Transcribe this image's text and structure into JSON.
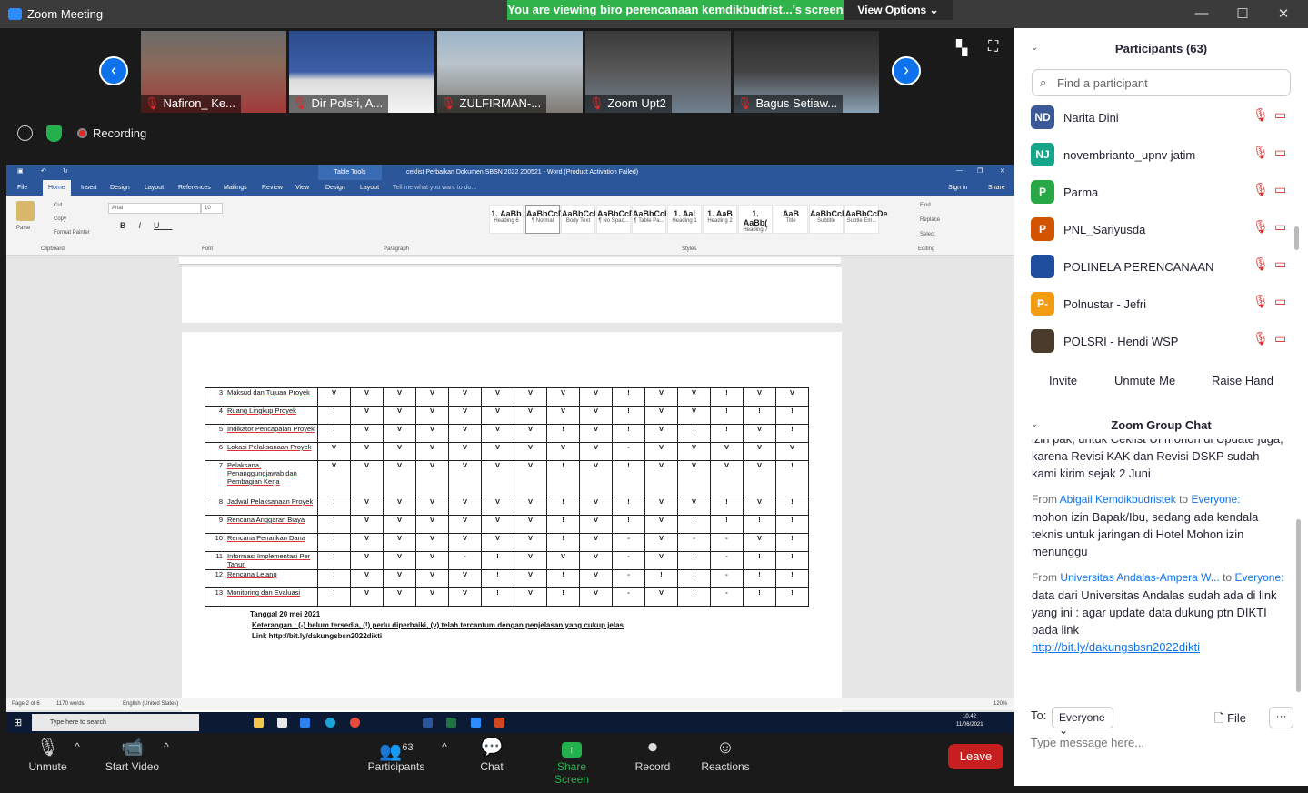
{
  "window": {
    "title": "Zoom Meeting"
  },
  "banner": {
    "text": "You are viewing biro perencanaan kemdikbudrist...'s screen",
    "view_options": "View Options ⌄"
  },
  "tiles": [
    {
      "label": "Nafiron_ Ke..."
    },
    {
      "label": "Dir Polsri, A..."
    },
    {
      "label": "ZULFIRMAN-..."
    },
    {
      "label": "Zoom Upt2"
    },
    {
      "label": "Bagus Setiaw..."
    }
  ],
  "recording": "Recording",
  "word": {
    "table_tools": "Table Tools",
    "doc_title": "ceklist Perbaikan Dokumen SBSN 2022 200521 - Word (Product Activation Failed)",
    "tabs": [
      "File",
      "Home",
      "Insert",
      "Design",
      "Layout",
      "References",
      "Mailings",
      "Review",
      "View",
      "Design",
      "Layout"
    ],
    "tell_me": "Tell me what you want to do...",
    "sign_in": "Sign in",
    "share": "Share",
    "font": "Arial",
    "size": "10",
    "clipboard": [
      "Paste",
      "Cut",
      "Copy",
      "Format Painter"
    ],
    "groups": [
      "Clipboard",
      "Font",
      "Paragraph",
      "Styles",
      "Editing"
    ],
    "styles": [
      {
        "p": "1. AaBb",
        "n": "Heading 6"
      },
      {
        "p": "AaBbCcDc",
        "n": "¶ Normal"
      },
      {
        "p": "AaBbCcI",
        "n": "Body Text"
      },
      {
        "p": "AaBbCcDc",
        "n": "¶ No Spac..."
      },
      {
        "p": "AaBbCcI",
        "n": "¶ Table Pa..."
      },
      {
        "p": "1. AaI",
        "n": "Heading 1"
      },
      {
        "p": "1. AaB",
        "n": "Heading 2"
      },
      {
        "p": "1. AaBb(",
        "n": "Heading 7"
      },
      {
        "p": "AaB",
        "n": "Title"
      },
      {
        "p": "AaBbCcD",
        "n": "Subtitle"
      },
      {
        "p": "AaBbCcDe",
        "n": "Subtle Em..."
      }
    ],
    "editing": [
      "Find",
      "Replace",
      "Select"
    ],
    "table_rows": [
      {
        "no": "3",
        "item": "Maksud dan Tujuan Proyek",
        "v": [
          "V",
          "V",
          "V",
          "V",
          "V",
          "V",
          "V",
          "V",
          "V",
          "!",
          "V",
          "V",
          "!",
          "V",
          "V"
        ]
      },
      {
        "no": "4",
        "item": "Ruang Lingkup Proyek",
        "v": [
          "!",
          "V",
          "V",
          "V",
          "V",
          "V",
          "V",
          "V",
          "V",
          "!",
          "V",
          "V",
          "!",
          "!",
          "!"
        ]
      },
      {
        "no": "5",
        "item": "Indikator Pencapaian Proyek",
        "v": [
          "!",
          "V",
          "V",
          "V",
          "V",
          "V",
          "V",
          "!",
          "V",
          "!",
          "V",
          "!",
          "!",
          "V",
          "!"
        ]
      },
      {
        "no": "6",
        "item": "Lokasi Pelaksanaan Proyek",
        "v": [
          "V",
          "V",
          "V",
          "V",
          "V",
          "V",
          "V",
          "V",
          "V",
          "-",
          "V",
          "V",
          "V",
          "V",
          "V"
        ]
      },
      {
        "no": "7",
        "item": "Pelaksana, Penanggungjawab dan Pembagian Kerja",
        "v": [
          "V",
          "V",
          "V",
          "V",
          "V",
          "V",
          "V",
          "!",
          "V",
          "!",
          "V",
          "V",
          "V",
          "V",
          "!"
        ]
      },
      {
        "no": "8",
        "item": "Jadwal Pelaksanaan Proyek",
        "v": [
          "!",
          "V",
          "V",
          "V",
          "V",
          "V",
          "V",
          "!",
          "V",
          "!",
          "V",
          "V",
          "!",
          "V",
          "!"
        ]
      },
      {
        "no": "9",
        "item": "Rencana Anggaran Biaya",
        "v": [
          "!",
          "V",
          "V",
          "V",
          "V",
          "V",
          "V",
          "!",
          "V",
          "!",
          "V",
          "!",
          "!",
          "!",
          "!"
        ]
      },
      {
        "no": "10",
        "item": "Rencana Penarikan Dana",
        "v": [
          "!",
          "V",
          "V",
          "V",
          "V",
          "V",
          "V",
          "!",
          "V",
          "-",
          "V",
          "-",
          "-",
          "V",
          "!"
        ]
      },
      {
        "no": "11",
        "item": "Informasi Implementasi Per Tahun",
        "v": [
          "!",
          "V",
          "V",
          "V",
          "-",
          "!",
          "V",
          "V",
          "V",
          "-",
          "V",
          "!",
          "-",
          "!",
          "!"
        ]
      },
      {
        "no": "12",
        "item": "Rencana Lelang",
        "v": [
          "!",
          "V",
          "V",
          "V",
          "V",
          "!",
          "V",
          "!",
          "V",
          "-",
          "!",
          "!",
          "-",
          "!",
          "!"
        ]
      },
      {
        "no": "13",
        "item": "Monitoring dan Evaluasi",
        "v": [
          "!",
          "V",
          "V",
          "V",
          "V",
          "!",
          "V",
          "!",
          "V",
          "-",
          "V",
          "!",
          "-",
          "!",
          "!"
        ]
      }
    ],
    "date_line": "Tanggal 20 mei 2021",
    "keterangan": "Keterangan : (-) belum tersedia, (!) perlu diperbaiki, (v) telah tercantum dengan penjelasan yang cukup jelas",
    "link": "Link http://bit.ly/dakungsbsn2022dikti",
    "status": {
      "page": "Page 2 of 6",
      "words": "1170 words",
      "lang": "English (United States)",
      "zoom": "120%"
    },
    "taskbar": {
      "search": "Type here to search",
      "time": "10.42",
      "date": "11/06/2021"
    }
  },
  "participants": {
    "title": "Participants (63)",
    "search_placeholder": "Find a participant",
    "list": [
      {
        "initials": "ND",
        "name": "Narita Dini",
        "color": "#3b5998"
      },
      {
        "initials": "NJ",
        "name": "novembrianto_upnv jatim",
        "color": "#17a589"
      },
      {
        "initials": "P",
        "name": "Parma",
        "color": "#28a745"
      },
      {
        "initials": "P",
        "name": "PNL_Sariyusda",
        "color": "#d35400"
      },
      {
        "initials": "",
        "name": "POLINELA PERENCANAAN",
        "color": "#1f4e9e"
      },
      {
        "initials": "P-",
        "name": "Polnustar - Jefri",
        "color": "#f39c12"
      },
      {
        "initials": "",
        "name": "POLSRI - Hendi WSP",
        "color": "#4a3b2a"
      }
    ],
    "invite": "Invite",
    "unmute_me": "Unmute Me",
    "raise_hand": "Raise Hand"
  },
  "chat": {
    "title": "Zoom Group Chat",
    "partial": "izin pak, untuk Ceklist UI mohon di Update juga, karena Revisi KAK dan Revisi DSKP sudah kami kirim sejak 2 Juni",
    "messages": [
      {
        "from_label": "From",
        "sender": "Abigail Kemdikbudristek",
        "to_label": "to",
        "to": "Everyone:",
        "text": "mohon izin Bapak/Ibu, sedang ada kendala teknis untuk jaringan di Hotel Mohon izin menunggu"
      },
      {
        "from_label": "From",
        "sender": "Universitas Andalas-Ampera W...",
        "to_label": "to",
        "to": "Everyone:",
        "text": "data dari Universitas Andalas sudah ada di link yang ini : agar update data dukung ptn DIKTI pada link",
        "link": "http://bit.ly/dakungsbsn2022dikti"
      }
    ],
    "to_label": "To:",
    "to_value": "Everyone",
    "file": "File",
    "more": "···",
    "placeholder": "Type message here..."
  },
  "controls": {
    "unmute": "Unmute",
    "start_video": "Start Video",
    "participants": "Participants",
    "participants_count": "63",
    "chat": "Chat",
    "share_screen": "Share Screen",
    "record": "Record",
    "reactions": "Reactions",
    "leave": "Leave"
  }
}
